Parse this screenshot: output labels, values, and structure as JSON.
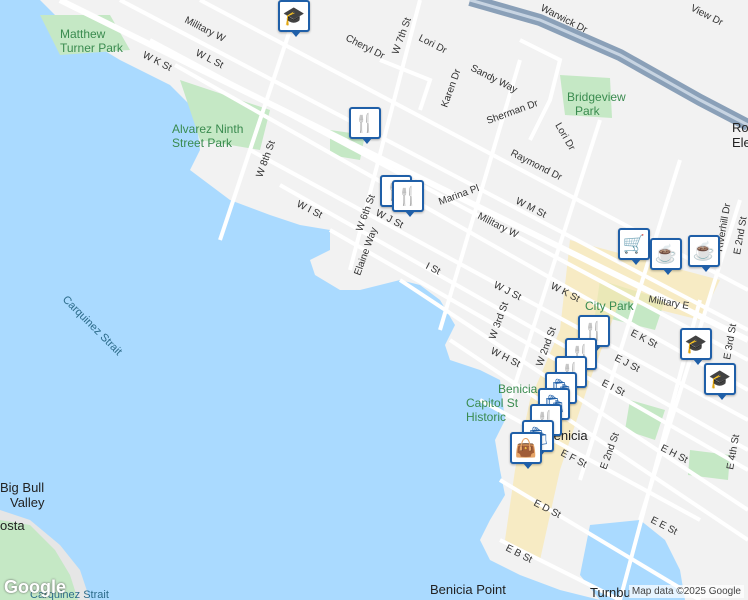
{
  "attribution": "Map data ©2025 Google",
  "logo": "Google",
  "streets": {
    "military_w_top": "Military W",
    "cheryl_dr": "Cheryl Dr",
    "lori_dr_top": "Lori Dr",
    "w7th_st": "W 7th St",
    "warwick_dr": "Warwick Dr",
    "view_dr": "View Dr",
    "wl_st": "W L St",
    "wk_st_top": "W K St",
    "karen_dr": "Karen Dr",
    "sandy_way": "Sandy Way",
    "sherman_dr": "Sherman Dr",
    "lori_dr": "Lori Dr",
    "raymond_dr": "Raymond Dr",
    "w8th_st": "W 8th St",
    "wm_st": "W M St",
    "military_w_mid": "Military W",
    "marina_pl": "Marina Pl",
    "wi_st": "W I St",
    "w6th_st": "W 6th St",
    "elaine_way": "Elaine Way",
    "wj_st_mid": "W J St",
    "i_st": "I St",
    "wj_st": "W J St",
    "wk_st": "W K St",
    "military_e": "Military E",
    "riverhill_dr": "Riverhill Dr",
    "e2nd_st_top": "E 2nd St",
    "w3rd_st": "W 3rd St",
    "w2nd_st": "W 2nd St",
    "wh_st": "W H St",
    "ek_st": "E K St",
    "ej_st": "E J St",
    "ei_st": "E I St",
    "e2nd_st": "E 2nd St",
    "eh_st": "E H St",
    "e4th_st": "E 4th St",
    "ef_st": "E F St",
    "ed_st": "E D St",
    "ee_st": "E E St",
    "eb_st": "E B St",
    "e3rd_st": "E 3rd St"
  },
  "places": {
    "matthew_turner_park": [
      "Matthew",
      "Turner Park"
    ],
    "alvarez_park": [
      "Alvarez Ninth",
      "Street Park"
    ],
    "bridgeview_park": [
      "Bridgeview",
      "Park"
    ],
    "city_park": "City Park",
    "benicia_capitol": [
      "Benicia",
      "Capitol St",
      "Historic"
    ],
    "benicia": "Benicia",
    "benicia_point": "Benicia Point",
    "turnbull": "Turnbu",
    "carquinez_strait": "Carquinez Strait",
    "carquinez_strait_bottom": "Carquinez Strait",
    "big_bull_valley": [
      "Big Bull",
      "Valley"
    ],
    "costa": "osta",
    "elementary": [
      "Ro",
      "Eleme"
    ]
  },
  "icons": {
    "restaurant": "🍴",
    "cafe": "☕",
    "shopping": "🛍",
    "cart": "🛒",
    "school": "🎓",
    "bag": "👜"
  },
  "colors": {
    "water": "#aadaff",
    "land": "#f2f2f2",
    "park": "#c5e8c5",
    "road": "#ffffff",
    "highway": "#8aa0b8",
    "business": "#f9e8b0",
    "poi_border": "#1f5fa8"
  }
}
